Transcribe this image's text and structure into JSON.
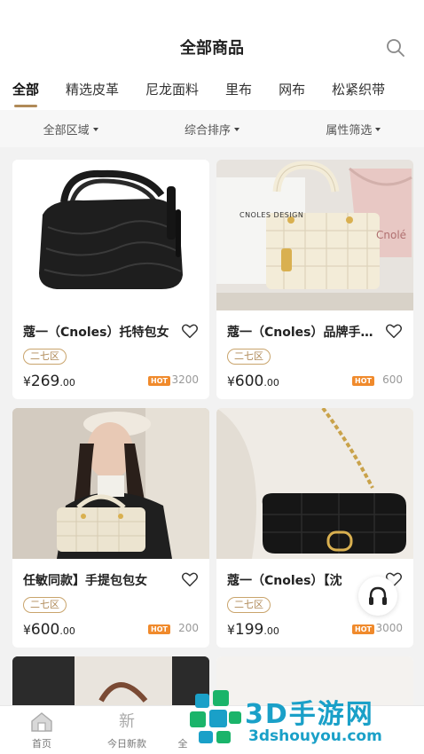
{
  "header": {
    "title": "全部商品"
  },
  "tabs": [
    {
      "label": "全部",
      "active": true
    },
    {
      "label": "精选皮革",
      "active": false
    },
    {
      "label": "尼龙面料",
      "active": false
    },
    {
      "label": "里布",
      "active": false
    },
    {
      "label": "网布",
      "active": false
    },
    {
      "label": "松紧织带",
      "active": false
    }
  ],
  "filters": [
    {
      "label": "全部区域"
    },
    {
      "label": "综合排序"
    },
    {
      "label": "属性筛选"
    }
  ],
  "products": [
    {
      "name": "蔻一（Cnoles）托特包女",
      "tag": "二七区",
      "currency": "¥",
      "price_int": "269",
      "price_dec": ".00",
      "hot_label": "HOT",
      "sales": "3200"
    },
    {
      "name": "蔻一（Cnoles）品牌手提包",
      "tag": "二七区",
      "currency": "¥",
      "price_int": "600",
      "price_dec": ".00",
      "hot_label": "HOT",
      "sales": "600",
      "image_text": "CNOLES DESIGN",
      "image_text2": "Cnolé"
    },
    {
      "name": "任敏同款】手提包包女",
      "tag": "二七区",
      "currency": "¥",
      "price_int": "600",
      "price_dec": ".00",
      "hot_label": "HOT",
      "sales": "200"
    },
    {
      "name": "蔻一（Cnoles）【沈",
      "tag": "二七区",
      "currency": "¥",
      "price_int": "199",
      "price_dec": ".00",
      "hot_label": "HOT",
      "sales": "3000"
    }
  ],
  "bottom_nav": [
    {
      "label": "首页",
      "icon": "home-icon"
    },
    {
      "label": "今日新款",
      "icon_text": "新"
    },
    {
      "label": "全"
    }
  ],
  "watermark": {
    "big": "3D手游网",
    "small": "3dshouyou.com"
  },
  "colors": {
    "accent": "#b08a58",
    "hot": "#f08a2c",
    "watermark": "#1aa0c8"
  }
}
